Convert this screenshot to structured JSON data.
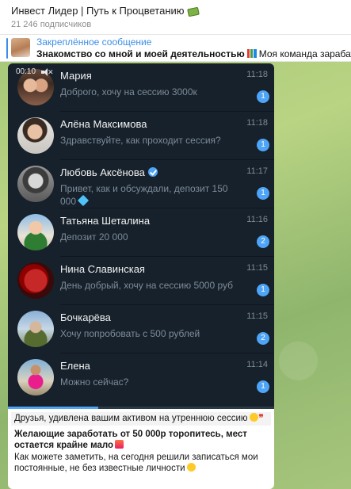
{
  "channel": {
    "title": "Инвест Лидер | Путь к Процветанию",
    "subscribers": "21 246 подписчиков",
    "title_icon": "money-icon"
  },
  "pinned": {
    "label": "Закреплённое сообщение",
    "title": "Знакомство со мной и моей деятельностью",
    "title_icon": "chart-icon",
    "preview": "Моя команда зарабатывает в"
  },
  "video": {
    "time": "00:10",
    "muted": true,
    "progress": 0.34
  },
  "chats": [
    {
      "name": "Мария",
      "preview": "Доброго, хочу на сессию 3000к",
      "time": "11:18",
      "unread": "1",
      "verified": false
    },
    {
      "name": "Алёна Максимова",
      "preview": "Здравствуйте, как проходит сессия?",
      "time": "11:18",
      "unread": "1",
      "verified": false
    },
    {
      "name": "Любовь Аксёнова",
      "preview": "Привет, как и обсуждали, депозит 150 000",
      "preview_icon": "gem-icon",
      "time": "11:17",
      "unread": "1",
      "verified": true
    },
    {
      "name": "Татьяна Шеталина",
      "preview": "Депозит 20 000",
      "time": "11:16",
      "unread": "2",
      "verified": false
    },
    {
      "name": "Нина Славинская",
      "preview": "День добрый, хочу на сессию 5000 руб",
      "time": "11:15",
      "unread": "1",
      "verified": false
    },
    {
      "name": "Бочкарёва",
      "preview": "Хочу попробовать с 500 рублей",
      "time": "11:15",
      "unread": "2",
      "verified": false
    },
    {
      "name": "Елена",
      "preview": "Можно сейчас?",
      "time": "11:14",
      "unread": "1",
      "verified": false
    }
  ],
  "caption": {
    "line1": "Друзья, удивлена вашим активом на утреннюю сессию",
    "line2": "Желающие заработать от 50 000р торопитесь, мест остается крайне мало",
    "line3": "Как можете заметить, на сегодня решили записаться мои постоянные, не без известные личности"
  },
  "colors": {
    "accent": "#4ea4f6",
    "chat_bg": "#17212b",
    "link": "#3a8ee6"
  }
}
